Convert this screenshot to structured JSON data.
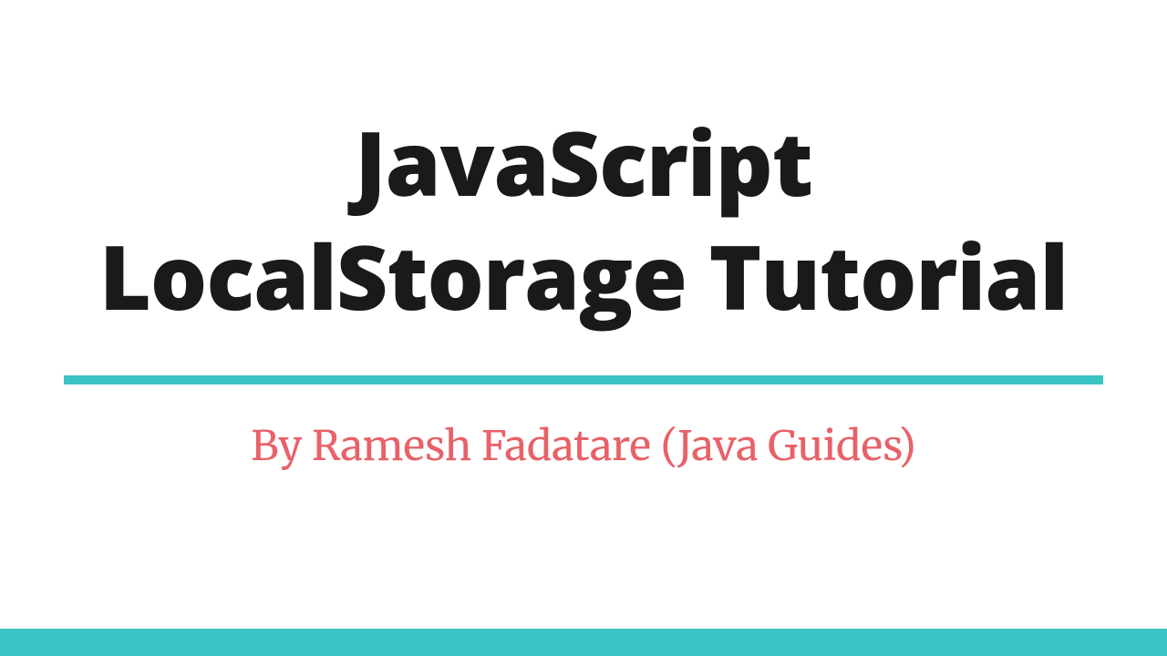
{
  "title_line1": "JavaScript",
  "title_line2": "LocalStorage Tutorial",
  "subtitle": "By Ramesh Fadatare (Java Guides)",
  "colors": {
    "accent": "#3cc4c4",
    "subtitle": "#e86168",
    "title": "#1a1a1a"
  }
}
